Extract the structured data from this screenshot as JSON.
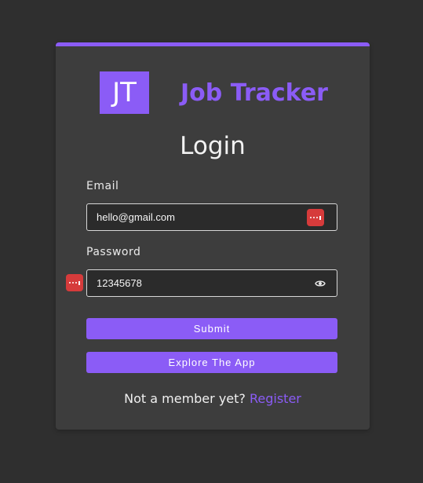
{
  "logo": {
    "initials": "JT",
    "name": "Job Tracker"
  },
  "form": {
    "title": "Login",
    "email_label": "Email",
    "email_value": "hello@gmail.com",
    "password_label": "Password",
    "password_value": "12345678",
    "submit_label": "Submit",
    "explore_label": "Explore The App"
  },
  "footer": {
    "prompt": "Not a member yet?",
    "register_link": "Register"
  },
  "colors": {
    "accent": "#8b5cf6",
    "background": "#2f2f2f",
    "card": "#3d3d3d",
    "password_manager_badge": "#d63b3b"
  },
  "icons": {
    "password_manager": "password-manager-icon",
    "show_password": "eye-icon"
  }
}
